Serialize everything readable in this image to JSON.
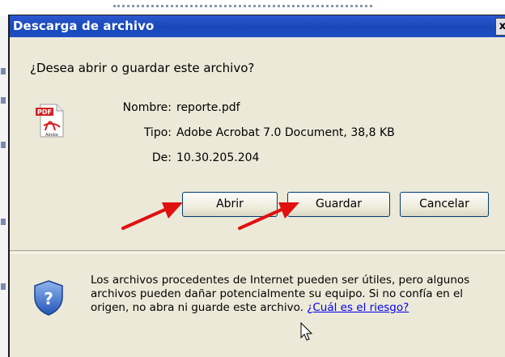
{
  "background": {
    "accent_color": "#1848b8"
  },
  "dialog": {
    "title": "Descarga de archivo",
    "close_glyph": "x",
    "question": "¿Desea abrir o guardar este archivo?",
    "file_icon": {
      "name": "pdf-file-icon",
      "badge": "PDF",
      "caption": "Adobe"
    },
    "fields": [
      {
        "label": "Nombre:",
        "value": "reporte.pdf"
      },
      {
        "label": "Tipo:",
        "value": "Adobe Acrobat 7.0 Document, 38,8 KB"
      },
      {
        "label": "De:",
        "value": "10.30.205.204"
      }
    ],
    "buttons": {
      "open": "Abrir",
      "save": "Guardar",
      "cancel": "Cancelar"
    },
    "warning": {
      "icon": "shield-question-icon",
      "text": "Los archivos procedentes de Internet pueden ser útiles, pero algunos archivos pueden dañar potencialmente su equipo. Si no confía en el origen, no abra ni guarde este archivo.",
      "link": "¿Cuál es el riesgo?"
    }
  },
  "colors": {
    "titlebar": "#1848b8",
    "dialog_bg": "#ece9d8",
    "button_border": "#003c74",
    "annotation_arrow": "#e01010",
    "link": "#0000ee"
  }
}
